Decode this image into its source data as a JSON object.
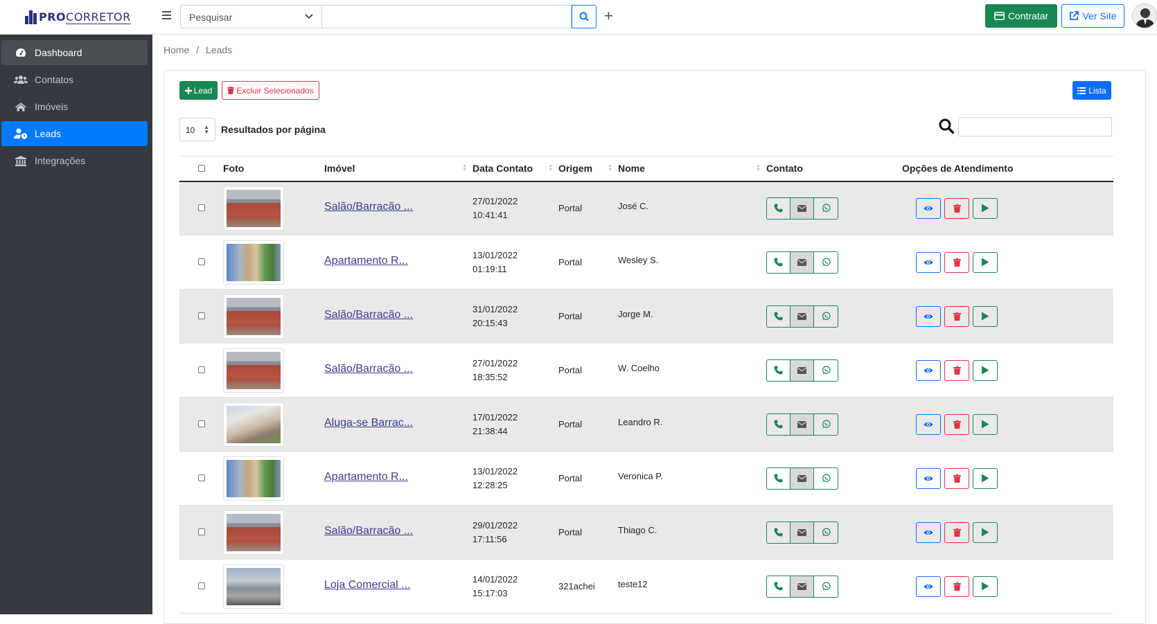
{
  "brand": {
    "name_bold": "PRO",
    "name_light": "CORRETOR"
  },
  "sidebar": {
    "items": [
      {
        "label": "Dashboard",
        "icon": "tachometer-icon"
      },
      {
        "label": "Contatos",
        "icon": "users-icon"
      },
      {
        "label": "Imóveis",
        "icon": "home-icon"
      },
      {
        "label": "Leads",
        "icon": "user-clock-icon"
      },
      {
        "label": "Integrações",
        "icon": "bank-icon"
      }
    ]
  },
  "topbar": {
    "search_select_value": "Pesquisar",
    "contratar_label": "Contratar",
    "versite_label": "Ver Site"
  },
  "breadcrumb": {
    "home": "Home",
    "sep": "/",
    "current": "Leads"
  },
  "toolbar": {
    "add_lead_label": "Lead",
    "delete_selected_label": "Excluir Selecionados",
    "list_label": "Lista",
    "per_page_value": "10",
    "per_page_label": "Resultados por página"
  },
  "table": {
    "headers": {
      "foto": "Foto",
      "imovel": "Imóvel",
      "data": "Data Contato",
      "origem": "Origem",
      "nome": "Nome",
      "contato": "Contato",
      "opcoes": "Opções de Atendimento"
    },
    "rows": [
      {
        "imovel": "Salão/Barracão ...",
        "date": "27/01/2022",
        "time": "10:41:41",
        "origem": "Portal",
        "nome": "José C.",
        "img": "salao"
      },
      {
        "imovel": "Apartamento R...",
        "date": "13/01/2022",
        "time": "01:19:11",
        "origem": "Portal",
        "nome": "Wesley S.",
        "img": "apto"
      },
      {
        "imovel": "Salão/Barracão ...",
        "date": "31/01/2022",
        "time": "20:15:43",
        "origem": "Portal",
        "nome": "Jorge M.",
        "img": "salao"
      },
      {
        "imovel": "Salão/Barracão ...",
        "date": "27/01/2022",
        "time": "18:35:52",
        "origem": "Portal",
        "nome": "W. Coelho",
        "img": "salao"
      },
      {
        "imovel": "Aluga-se Barrac...",
        "date": "17/01/2022",
        "time": "21:38:44",
        "origem": "Portal",
        "nome": "Leandro R.",
        "img": "aluga"
      },
      {
        "imovel": "Apartamento R...",
        "date": "13/01/2022",
        "time": "12:28:25",
        "origem": "Portal",
        "nome": "Veronica P.",
        "img": "apto"
      },
      {
        "imovel": "Salão/Barracão ...",
        "date": "29/01/2022",
        "time": "17:11:56",
        "origem": "Portal",
        "nome": "Thiago C.",
        "img": "salao"
      },
      {
        "imovel": "Loja Comercial ...",
        "date": "14/01/2022",
        "time": "15:17:03",
        "origem": "321achei",
        "nome": "teste12",
        "img": "loja"
      }
    ]
  },
  "colors": {
    "primary": "#0d6efd",
    "success": "#198754",
    "danger": "#dc3545",
    "sidebar": "#343a40"
  }
}
